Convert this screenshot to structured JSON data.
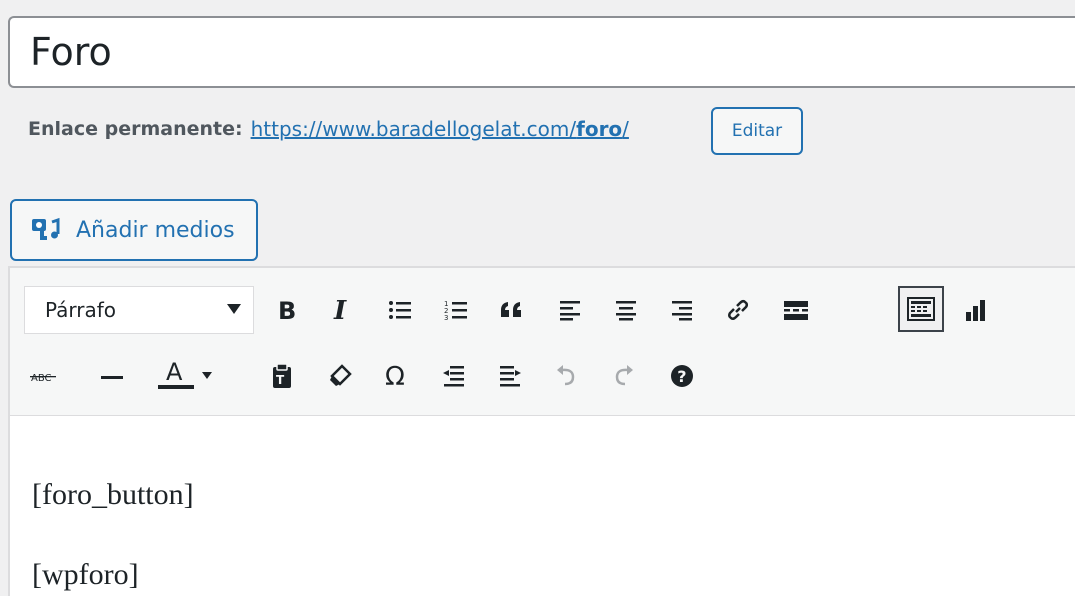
{
  "title": {
    "value": "Foro"
  },
  "permalink": {
    "label": "Enlace permanente:",
    "url_prefix": "https://www.baradellogelat.com/",
    "url_slug": "foro",
    "url_suffix": "/",
    "edit_label": "Editar"
  },
  "media": {
    "add_label": "Añadir medios",
    "icon": "media-icon"
  },
  "toolbar": {
    "format_select": "Párrafo",
    "row1": [
      "bold-icon",
      "italic-icon",
      "bullet-list-icon",
      "numbered-list-icon",
      "blockquote-icon",
      "align-left-icon",
      "align-center-icon",
      "align-right-icon",
      "link-icon",
      "read-more-icon",
      "toolbar-toggle-icon",
      "chart-icon"
    ],
    "row2": [
      "strikethrough-icon",
      "horizontal-line-icon",
      "text-color-icon",
      "paste-text-icon",
      "clear-formatting-icon",
      "special-character-icon",
      "outdent-icon",
      "indent-icon",
      "undo-icon",
      "redo-icon",
      "help-icon"
    ],
    "text_color_letter": "A",
    "strike_label": "ABC"
  },
  "content": {
    "paragraphs": [
      "[foro_button]",
      "[wpforo]"
    ]
  },
  "colors": {
    "accent": "#2271b1",
    "text": "#1d2327",
    "background": "#f0f0f1"
  }
}
